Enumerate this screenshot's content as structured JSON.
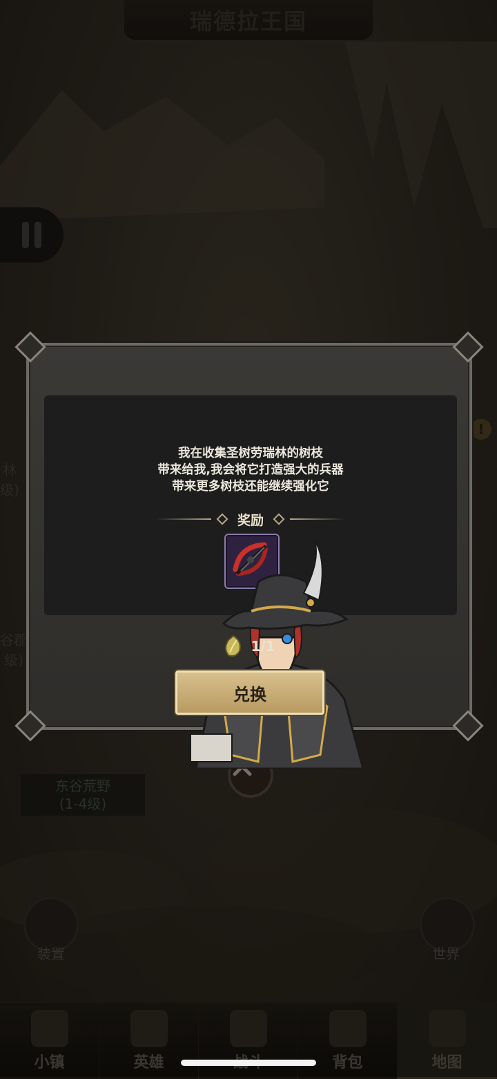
{
  "map": {
    "region_title": "瑞德拉王国",
    "labels": {
      "left_top_fragment": "林",
      "left_top_level_fragment": "级)",
      "left_mid_fragment": "谷郡",
      "left_mid_level_fragment": "级)",
      "east_valley_name": "东谷荒野",
      "east_valley_level": "(1-4级)"
    },
    "side_buttons": {
      "left": "装置",
      "right": "世界"
    },
    "pause_icon": "pause-icon",
    "alert_icon": "exclamation-icon",
    "battle_node_icon": "crossed-swords-icon"
  },
  "dialog": {
    "npc": "hunter-npc-portrait",
    "quest_lines": [
      "我在收集圣树劳瑞林的树枝",
      "带来给我,我会将它打造强大的兵器",
      "带来更多树枝还能继续强化它"
    ],
    "reward_title": "奖励",
    "reward_item_icon": "crossbow-icon",
    "cost_icon": "branch-token-icon",
    "cost_value": "1/1",
    "exchange_label": "兑换"
  },
  "bottom_nav": {
    "items": [
      {
        "label": "小镇",
        "icon": "town-icon"
      },
      {
        "label": "英雄",
        "icon": "hero-icon"
      },
      {
        "label": "战斗",
        "icon": "battle-icon"
      },
      {
        "label": "背包",
        "icon": "backpack-icon"
      },
      {
        "label": "地图",
        "icon": "map-icon"
      }
    ],
    "active": "地图"
  },
  "colors": {
    "accent_gold": "#c9ad74",
    "dialog_bg": "#343330",
    "panel_bg": "#1d1d1d",
    "reward_slot": "#2f2240"
  }
}
